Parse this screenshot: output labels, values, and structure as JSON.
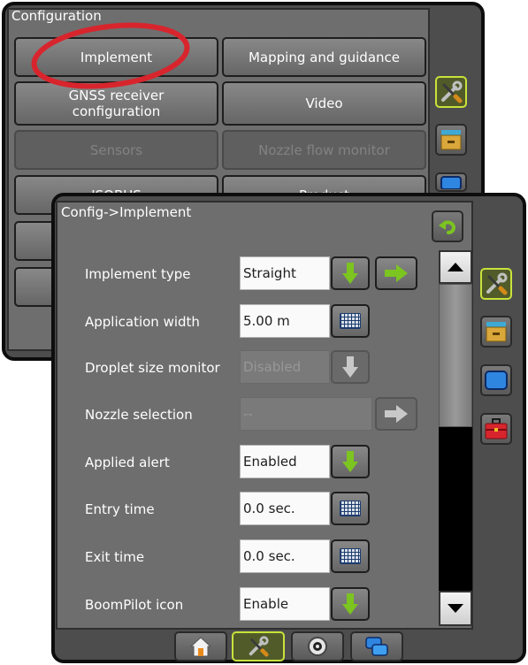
{
  "back_screen": {
    "title": "Configuration",
    "buttons": {
      "implement": "Implement",
      "mapping": "Mapping and guidance",
      "gnss_line1": "GNSS receiver",
      "gnss_line2": "configuration",
      "video": "Video",
      "sensors": "Sensors",
      "nozzle_flow": "Nozzle flow monitor",
      "isobus": "ISOBUS",
      "product": "Product"
    }
  },
  "front_screen": {
    "title": "Config->Implement",
    "rows": [
      {
        "label": "Implement type",
        "value": "Straight",
        "control": "arrow-down",
        "extra": "arrow-right"
      },
      {
        "label": "Application width",
        "value": "5.00 m",
        "control": "keyboard"
      },
      {
        "label": "Droplet size monitor",
        "value": "Disabled",
        "control": "arrow-down",
        "disabled": true
      },
      {
        "label": "Nozzle selection",
        "value": "--",
        "control": "arrow-right",
        "disabled": true
      },
      {
        "label": "Applied alert",
        "value": "Enabled",
        "control": "arrow-down"
      },
      {
        "label": "Entry time",
        "value": "0.0 sec.",
        "control": "keyboard"
      },
      {
        "label": "Exit time",
        "value": "0.0 sec.",
        "control": "keyboard"
      },
      {
        "label": "BoomPilot icon",
        "value": "Enable",
        "control": "arrow-down"
      }
    ]
  },
  "colors": {
    "accent_active": "#c9e23c",
    "arrow_green": "#7cc420",
    "frame": "#0d0d0d",
    "panel": "#6e6e6e"
  },
  "icons": {
    "side_tabs": [
      "tools-icon",
      "drawer-icon",
      "monitor-icon",
      "toolbox-icon"
    ],
    "bottom_nav": [
      "home-icon",
      "tools-icon",
      "gauge-icon",
      "multiscreen-icon"
    ]
  }
}
